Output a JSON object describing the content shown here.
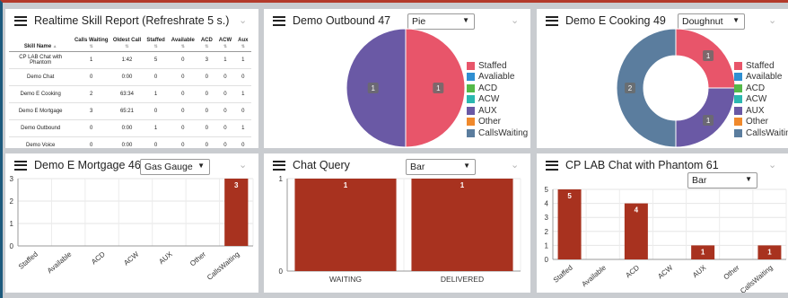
{
  "colors": {
    "staffed": "#e8556a",
    "available": "#2f8fd2",
    "acd": "#54b949",
    "acw": "#2bb7b0",
    "aux": "#6a59a5",
    "other": "#f0892c",
    "callswaiting": "#5b7d9e",
    "bar": "#a8321f"
  },
  "panels": {
    "skill_report": {
      "title": "Realtime Skill Report (Refreshrate 5 s.)",
      "headers": [
        "Skill Name",
        "Calls Waiting",
        "Oldest Call",
        "Staffed",
        "Available",
        "ACD",
        "ACW",
        "Aux"
      ],
      "rows": [
        [
          "CP LAB Chat with Phantom",
          "1",
          "1:42",
          "5",
          "0",
          "3",
          "1",
          "1"
        ],
        [
          "Demo Chat",
          "0",
          "0:00",
          "0",
          "0",
          "0",
          "0",
          "0"
        ],
        [
          "Demo E Cooking",
          "2",
          "63:34",
          "1",
          "0",
          "0",
          "0",
          "1"
        ],
        [
          "Demo E Mortgage",
          "3",
          "65:21",
          "0",
          "0",
          "0",
          "0",
          "0"
        ],
        [
          "Demo Outbound",
          "0",
          "0:00",
          "1",
          "0",
          "0",
          "0",
          "1"
        ],
        [
          "Demo Voice",
          "0",
          "0:00",
          "0",
          "0",
          "0",
          "0",
          "0"
        ]
      ]
    },
    "outbound": {
      "title": "Demo Outbound 47",
      "select": "Pie",
      "legend": [
        "Staffed",
        "Avaliable",
        "ACD",
        "ACW",
        "AUX",
        "Other",
        "CallsWaiting"
      ],
      "slice_labels": [
        "1",
        "1"
      ]
    },
    "cooking": {
      "title": "Demo E Cooking 49",
      "select": "Doughnut",
      "legend": [
        "Staffed",
        "Available",
        "ACD",
        "ACW",
        "AUX",
        "Other",
        "CallsWaiting"
      ],
      "slice_labels": [
        "1",
        "1",
        "2"
      ]
    },
    "mortgage": {
      "title": "Demo E Mortgage 46",
      "select": "Gas Gauge"
    },
    "chat_query": {
      "title": "Chat Query",
      "select": "Bar"
    },
    "phantom": {
      "title": "CP LAB Chat with Phantom 61",
      "select": "Bar"
    }
  },
  "chart_data": [
    {
      "type": "pie",
      "panel": "Demo Outbound 47",
      "categories": [
        "Staffed",
        "Avaliable",
        "ACD",
        "ACW",
        "AUX",
        "Other",
        "CallsWaiting"
      ],
      "values": [
        1,
        0,
        0,
        0,
        1,
        0,
        0
      ]
    },
    {
      "type": "pie",
      "panel": "Demo E Cooking 49",
      "categories": [
        "Staffed",
        "Available",
        "ACD",
        "ACW",
        "AUX",
        "Other",
        "CallsWaiting"
      ],
      "values": [
        1,
        0,
        0,
        0,
        1,
        0,
        2
      ]
    },
    {
      "type": "bar",
      "panel": "Demo E Mortgage 46",
      "categories": [
        "Staffed",
        "Available",
        "ACD",
        "ACW",
        "AUX",
        "Other",
        "CallsWaiting"
      ],
      "values": [
        0,
        0,
        0,
        0,
        0,
        0,
        3
      ],
      "ylim": [
        0,
        3
      ],
      "yticks": [
        "0",
        "1",
        "2",
        "3"
      ]
    },
    {
      "type": "bar",
      "panel": "Chat Query",
      "categories": [
        "WAITING",
        "DELIVERED"
      ],
      "values": [
        1,
        1
      ],
      "ylim": [
        0,
        1
      ],
      "yticks": [
        "0",
        "1"
      ]
    },
    {
      "type": "bar",
      "panel": "CP LAB Chat with Phantom 61",
      "categories": [
        "Staffed",
        "Available",
        "ACD",
        "ACW",
        "AUX",
        "Other",
        "CallsWaiting"
      ],
      "values": [
        5,
        0,
        4,
        0,
        1,
        0,
        1
      ],
      "ylim": [
        0,
        5
      ],
      "yticks": [
        "0",
        "1",
        "2",
        "3",
        "4",
        "5"
      ]
    }
  ]
}
